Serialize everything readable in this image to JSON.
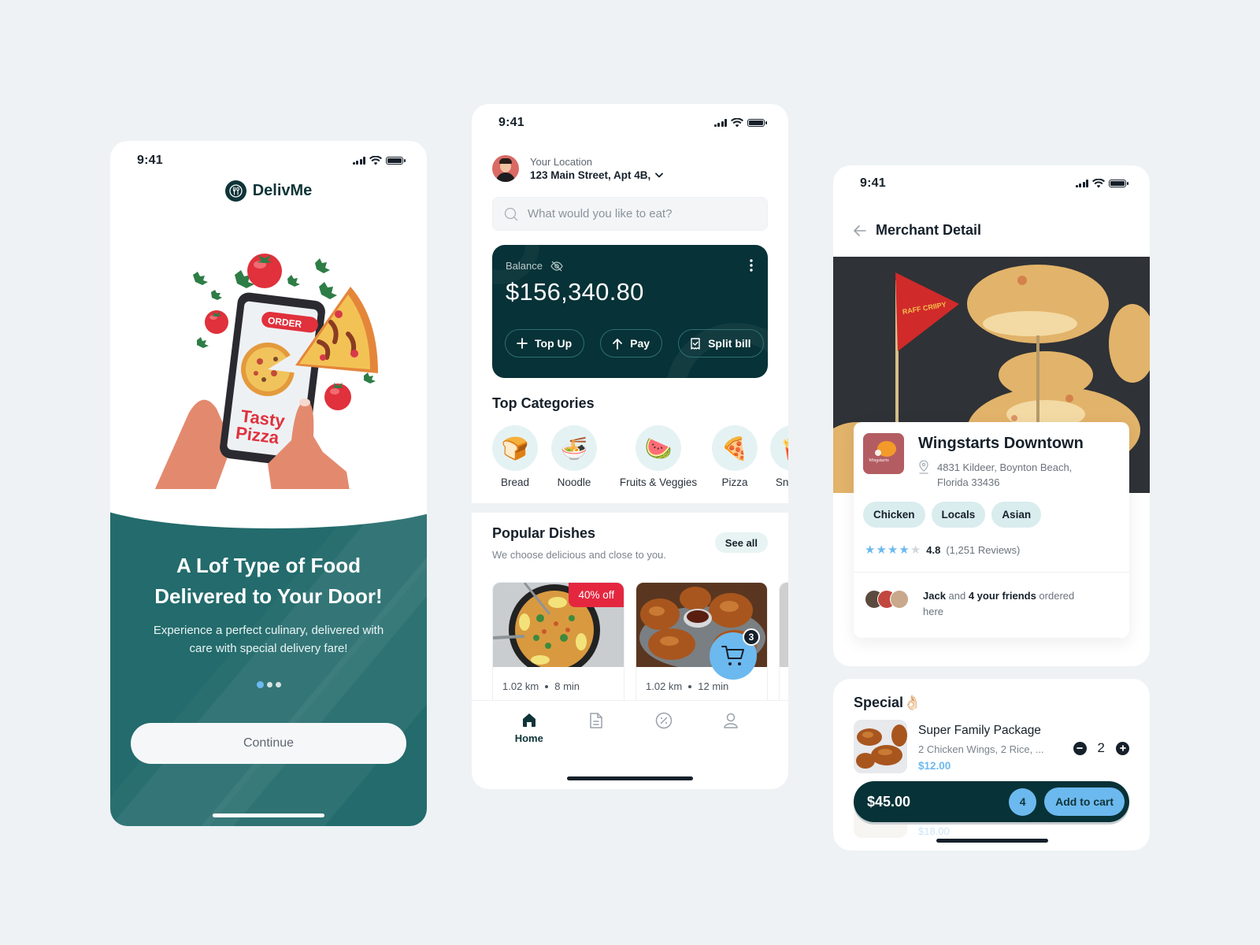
{
  "status_bar": {
    "time": "9:41"
  },
  "onboarding": {
    "brand_name": "DelivMe",
    "illustration": {
      "order_label": "ORDER",
      "pizza_text_line1": "Tasty",
      "pizza_text_line2": "Pizza"
    },
    "title_line1": "A Lof Type of Food",
    "title_line2": "Delivered to Your Door!",
    "subtitle_line1": "Experience a perfect culinary, delivered with",
    "subtitle_line2": "care with special delivery fare!",
    "pagination": {
      "total": 3,
      "active": 1
    },
    "continue_label": "Continue"
  },
  "home": {
    "location_label": "Your Location",
    "location_address": "123 Main Street, Apt 4B,",
    "search_placeholder": "What would you like to eat?",
    "balance": {
      "label": "Balance",
      "amount": "$156,340.80",
      "actions": [
        {
          "label": "Top Up",
          "icon": "plus-icon"
        },
        {
          "label": "Pay",
          "icon": "arrow-up-icon"
        },
        {
          "label": "Split bill",
          "icon": "receipt-icon"
        }
      ]
    },
    "top_categories_title": "Top Categories",
    "categories": [
      {
        "label": "Bread",
        "emoji": "🍞"
      },
      {
        "label": "Noodle",
        "emoji": "🍜"
      },
      {
        "label": "Fruits & Veggies",
        "emoji": "🍉"
      },
      {
        "label": "Pizza",
        "emoji": "🍕"
      },
      {
        "label": "Snacks",
        "emoji": "🍟"
      }
    ],
    "popular_title": "Popular Dishes",
    "popular_subtitle": "We choose delicious and close to you.",
    "see_all_label": "See all",
    "dishes": [
      {
        "distance": "1.02 km",
        "time": "8 min",
        "discount": "40% off"
      },
      {
        "distance": "1.02 km",
        "time": "12 min",
        "discount": ""
      }
    ],
    "cart_badge": "3",
    "tabs": [
      {
        "label": "Home",
        "icon": "home-icon",
        "active": true
      },
      {
        "label": "",
        "icon": "orders-icon",
        "active": false
      },
      {
        "label": "",
        "icon": "promo-icon",
        "active": false
      },
      {
        "label": "",
        "icon": "profile-icon",
        "active": false
      }
    ]
  },
  "merchant": {
    "page_title": "Merchant Detail",
    "hero_flag_text": "RAFF CRIIPY",
    "name": "Wingstarts Downtown",
    "logo_text": "Wingstarts",
    "address_line1": "4831 Kildeer, Boynton Beach,",
    "address_line2": "Florida 33436",
    "tags": [
      "Chicken",
      "Locals",
      "Asian"
    ],
    "rating": {
      "score": "4.8",
      "stars_filled": 4,
      "stars_total": 5,
      "reviews": "(1,251 Reviews)"
    },
    "friends": {
      "name": "Jack",
      "connector": " and ",
      "count_text": "4 your friends",
      "suffix": " ordered here"
    },
    "special_title": "Special👌🏻",
    "special_item": {
      "name": "Super Family Package",
      "description": "2 Chicken Wings, 2 Rice, ...",
      "price": "$12.00",
      "quantity": "2"
    },
    "next_item_price": "$18.00",
    "cart_bar": {
      "total": "$45.00",
      "count": "4",
      "add_label": "Add to cart"
    }
  },
  "colors": {
    "background": "#eef2f5",
    "teal_primary": "#236b6c",
    "dark_teal": "#073237",
    "accent_blue": "#6cb9ef",
    "discount_red": "#e4273f"
  }
}
